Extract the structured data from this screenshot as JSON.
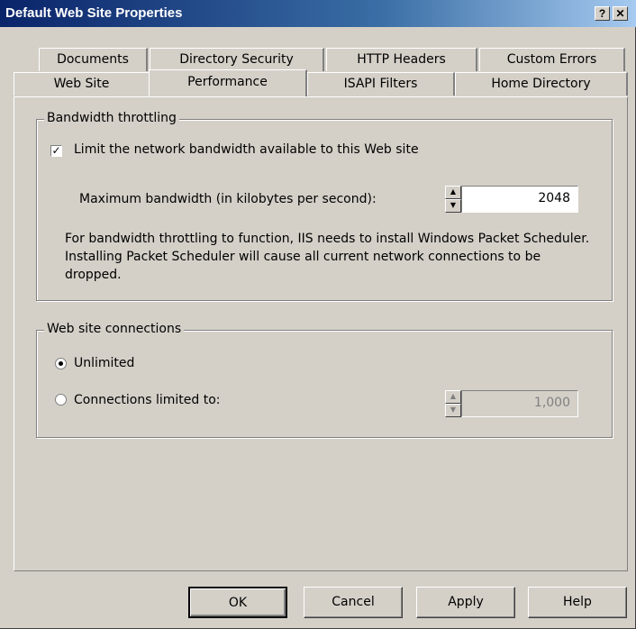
{
  "window": {
    "title": "Default Web Site Properties",
    "help_label": "?",
    "close_label": "✕"
  },
  "tabs_back": [
    {
      "label": "Documents"
    },
    {
      "label": "Directory Security"
    },
    {
      "label": "HTTP Headers"
    },
    {
      "label": "Custom Errors"
    }
  ],
  "tabs_front": [
    {
      "label": "Web Site"
    },
    {
      "label": "Performance",
      "active": true
    },
    {
      "label": "ISAPI Filters"
    },
    {
      "label": "Home Directory"
    }
  ],
  "bandwidth": {
    "legend": "Bandwidth throttling",
    "limit_checked": true,
    "limit_label": "Limit the network bandwidth available to this Web site",
    "max_label": "Maximum bandwidth (in kilobytes per second):",
    "max_value": "2048",
    "note": "For bandwidth throttling to function, IIS needs to install Windows Packet Scheduler. Installing Packet Scheduler will cause all current network connections to be dropped."
  },
  "connections": {
    "legend": "Web site connections",
    "unlimited_label": "Unlimited",
    "unlimited_selected": true,
    "limited_label": "Connections limited to:",
    "limited_value": "1,000"
  },
  "buttons": {
    "ok": "OK",
    "cancel": "Cancel",
    "apply": "Apply",
    "help": "Help"
  },
  "icons": {
    "check": "checkmark-icon",
    "spin_up": "spin-up-icon",
    "spin_down": "spin-down-icon"
  }
}
